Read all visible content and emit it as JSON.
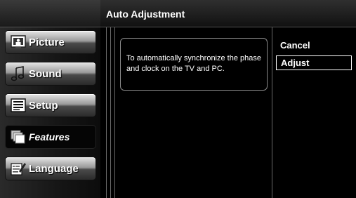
{
  "header": {
    "title": "Auto Adjustment"
  },
  "sidebar": {
    "items": [
      {
        "label": "Picture",
        "icon": "picture-icon",
        "selected": false
      },
      {
        "label": "Sound",
        "icon": "sound-icon",
        "selected": false
      },
      {
        "label": "Setup",
        "icon": "setup-icon",
        "selected": false
      },
      {
        "label": "Features",
        "icon": "features-icon",
        "selected": true
      },
      {
        "label": "Language",
        "icon": "language-icon",
        "selected": false
      }
    ]
  },
  "message": {
    "text": "To automatically synchronize the phase and clock on the TV and PC."
  },
  "options": [
    {
      "label": "Cancel",
      "selected": false
    },
    {
      "label": "Adjust",
      "selected": true
    }
  ]
}
